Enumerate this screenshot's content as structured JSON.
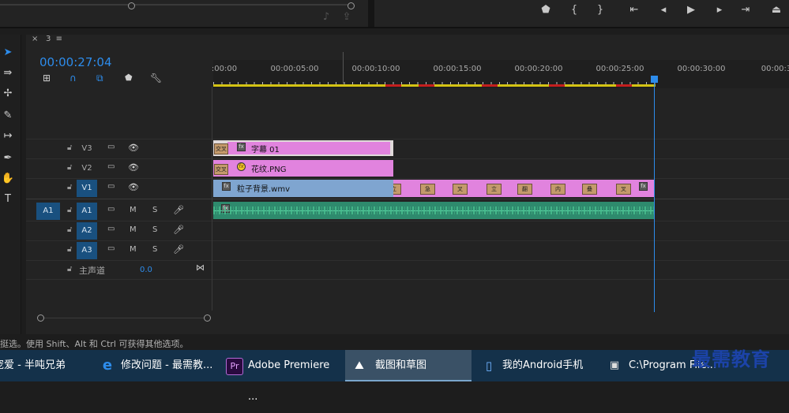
{
  "sequence": {
    "tab_close": "×",
    "tab_name": "3",
    "menu_icon": "≡",
    "timecode": "00:00:27:04"
  },
  "ruler": {
    "labels": [
      ":00:00",
      "00:00:05:00",
      "00:00:10:00",
      "00:00:15:00",
      "00:00:20:00",
      "00:00:25:00",
      "00:00:30:00",
      "00:00:3"
    ]
  },
  "tracks": {
    "v3": {
      "name": "V3"
    },
    "v2": {
      "name": "V2"
    },
    "v1": {
      "name": "V1"
    },
    "a1": {
      "source": "A1",
      "name": "A1",
      "m": "M",
      "s": "S"
    },
    "a2": {
      "name": "A2",
      "m": "M",
      "s": "S"
    },
    "a3": {
      "name": "A3",
      "m": "M",
      "s": "S"
    },
    "master": {
      "label": "主声道",
      "value": "0.0"
    }
  },
  "clips": {
    "v3_title": "字幕 01",
    "v2_title": "花纹.PNG",
    "v1_title": "粒子背景.wmv",
    "v3_transition": "交叉",
    "v2_transition": "交叉",
    "v1_markers": [
      "立",
      "急",
      "叉",
      "立",
      "翻",
      "内",
      "叠",
      "叉"
    ]
  },
  "status_text": "挺选。使用 Shift、Alt 和 Ctrl 可获得其他选项。",
  "taskbar": {
    "items": [
      {
        "label": "宠爱 - 半吨兄弟"
      },
      {
        "label": "修改问题 - 最需教..."
      },
      {
        "label": "Adobe Premiere ..."
      },
      {
        "label": "截图和草图"
      },
      {
        "label": "我的Android手机"
      },
      {
        "label": "C:\\Program File..."
      }
    ]
  },
  "watermark": "最需教育",
  "colors": {
    "accent": "#2d8ceb",
    "video_clip": "#e183de",
    "v1_clip": "#7fa5d0",
    "audio_clip": "#2e8a6d",
    "taskbar": "#14314a"
  }
}
